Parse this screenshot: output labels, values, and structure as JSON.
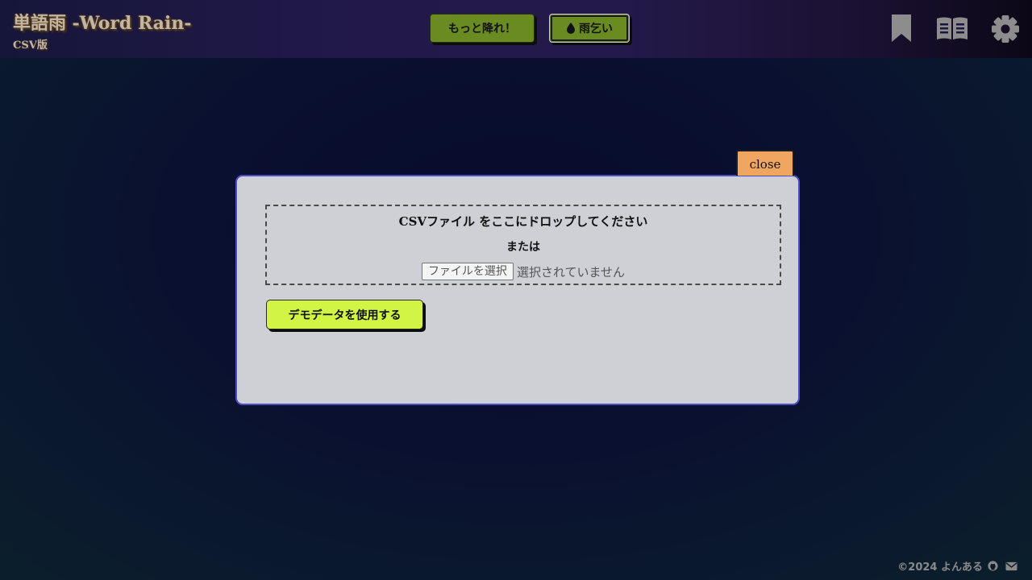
{
  "header": {
    "title": "単語雨 -Word Rain-",
    "subtitle": "CSV版",
    "more_rain_label": "もっと降れ！",
    "ask_rain_label": "雨乞い",
    "icons": [
      "bookmark-icon",
      "book-reader-icon",
      "gear-icon"
    ]
  },
  "modal": {
    "close_label": "close",
    "drop_prompt": "CSVファイル をここにドロップしてください",
    "or_label": "または",
    "file_button_label": "ファイルを選択",
    "file_status": "選択されていません",
    "demo_button_label": "デモデータを使用する"
  },
  "footer": {
    "copyright": "©2024 よんある",
    "icons": [
      "github-icon",
      "mail-icon"
    ]
  },
  "colors": {
    "accent_green": "#6a8a22",
    "demo_button": "#d2f545",
    "close_button": "#f0a560",
    "modal_border": "#4a4fc9",
    "modal_background": "#cfd0d6"
  }
}
